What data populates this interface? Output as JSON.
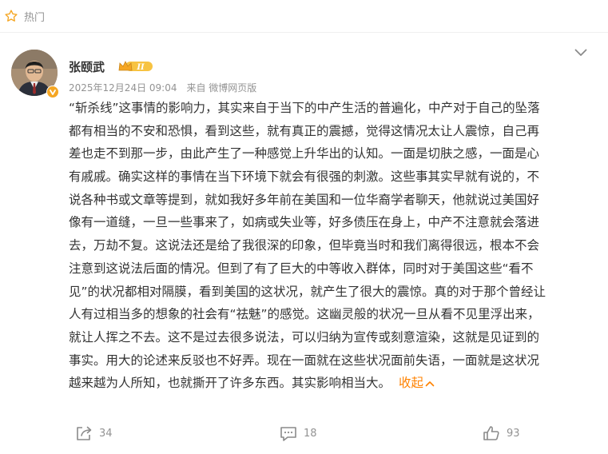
{
  "header": {
    "label": "热门"
  },
  "post": {
    "author": "张颐武",
    "rank_badge": "II",
    "date": "2025年12月24日 09:04",
    "source": "来自 微博网页版",
    "lines": [
      "“斩杀线”这事情的影响力，其实来自于当下的中产生活的普遍化，中产对于自己的坠落",
      "都有相当的不安和恐惧，看到这些，就有真正的震撼，觉得这情况太让人震惊，自己再",
      "差也走不到那一步，由此产生了一种感觉上升华出的认知。一面是切肤之感，一面是心",
      "有戚戚。确实这样的事情在当下环境下就会有很强的刺激。这些事其实早就有说的，不",
      "说各种书或文章等提到，就如我好多年前在美国和一位华裔学者聊天，他就说过美国好",
      "像有一道缝，一旦一些事来了，如病或失业等，好多债压在身上，中产不注意就会落进",
      "去，万劫不复。这说法还是给了我很深的印象，但毕竟当时和我们离得很远，根本不会",
      "注意到这说法后面的情况。但到了有了巨大的中等收入群体，同时对于美国这些“看不",
      "见”的状况都相对隔膜，看到美国的这状况，就产生了很大的震惊。真的对于那个曾经让",
      "人有过相当多的想象的社会有“祛魅”的感觉。这幽灵般的状况一旦从看不见里浮出来，",
      "就让人挥之不去。这不是过去很多说法，可以归纳为宣传或刻意渲染，这就是见证到的",
      "事实。用大的论述来反驳也不好弄。现在一面就在这些状况面前失语，一面就是这状况",
      "越来越为人所知，也就撕开了许多东西。其实影响相当大。"
    ],
    "collapse_label": "收起"
  },
  "actions": {
    "share_count": "34",
    "comment_count": "18",
    "like_count": "93"
  },
  "colors": {
    "accent": "#ff8200",
    "meta_gray": "#939393",
    "text": "#333333",
    "badge_gold": "#f5a623"
  },
  "icons": [
    "star-outline-icon",
    "chevron-down-icon",
    "verified-badge-icon",
    "rank-crown-icon",
    "chevron-up-icon",
    "share-icon",
    "comment-icon",
    "like-icon"
  ]
}
